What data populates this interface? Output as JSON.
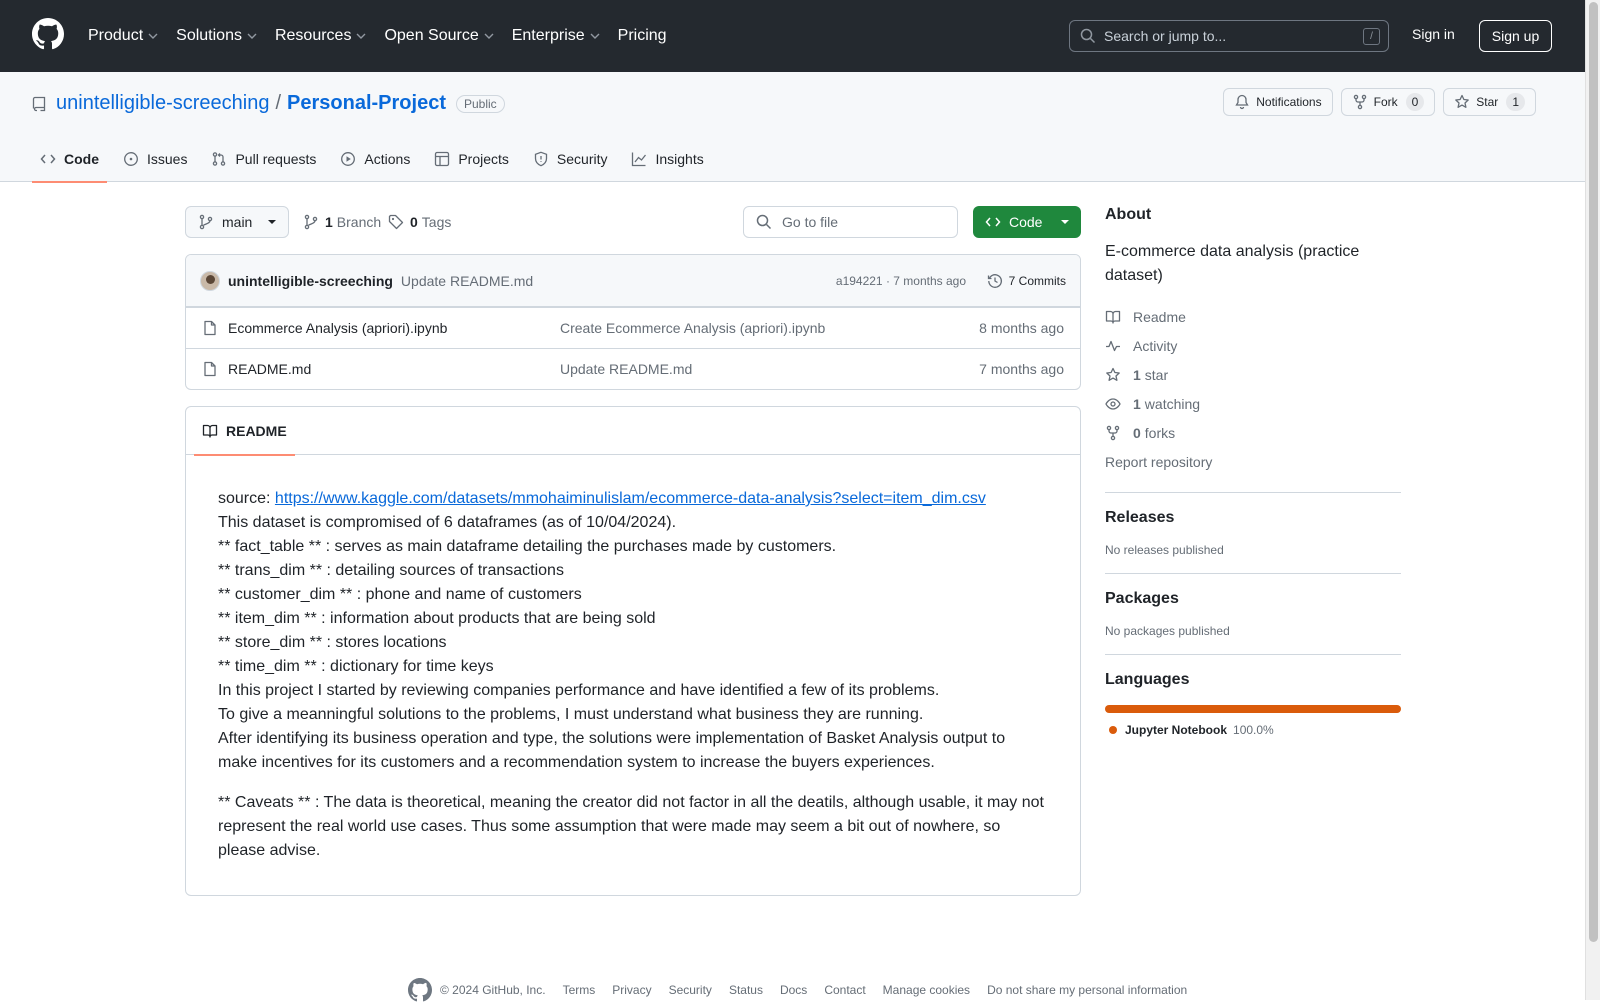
{
  "header": {
    "nav": [
      {
        "label": "Product",
        "has_menu": true
      },
      {
        "label": "Solutions",
        "has_menu": true
      },
      {
        "label": "Resources",
        "has_menu": true
      },
      {
        "label": "Open Source",
        "has_menu": true
      },
      {
        "label": "Enterprise",
        "has_menu": true
      },
      {
        "label": "Pricing",
        "has_menu": false
      }
    ],
    "search_placeholder": "Search or jump to...",
    "search_shortcut": "/",
    "sign_in": "Sign in",
    "sign_up": "Sign up"
  },
  "repo": {
    "owner": "unintelligible-screeching",
    "separator": "/",
    "name": "Personal-Project",
    "visibility": "Public",
    "notifications_label": "Notifications",
    "fork_label": "Fork",
    "fork_count": "0",
    "star_label": "Star",
    "star_count": "1",
    "tabs": [
      {
        "label": "Code",
        "icon": "code-icon",
        "active": true
      },
      {
        "label": "Issues",
        "icon": "issue-icon",
        "active": false
      },
      {
        "label": "Pull requests",
        "icon": "pull-request-icon",
        "active": false
      },
      {
        "label": "Actions",
        "icon": "play-icon",
        "active": false
      },
      {
        "label": "Projects",
        "icon": "table-icon",
        "active": false
      },
      {
        "label": "Security",
        "icon": "shield-icon",
        "active": false
      },
      {
        "label": "Insights",
        "icon": "graph-icon",
        "active": false
      }
    ]
  },
  "toolbar": {
    "branch": "main",
    "branch_count": "1",
    "branch_label": "Branch",
    "tag_count": "0",
    "tag_label": "Tags",
    "goto_placeholder": "Go to file",
    "code_button": "Code"
  },
  "latest_commit": {
    "author": "unintelligible-screeching",
    "message": "Update README.md",
    "meta": "a194221 · 7 months ago",
    "commits_label": "7 Commits"
  },
  "files": [
    {
      "name": "Ecommerce Analysis (apriori).ipynb",
      "message": "Create Ecommerce Analysis (apriori).ipynb",
      "date": "8 months ago"
    },
    {
      "name": "README.md",
      "message": "Update README.md",
      "date": "7 months ago"
    }
  ],
  "readme": {
    "tab_label": "README",
    "source_prefix": "source: ",
    "source_url": "https://www.kaggle.com/datasets/mmohaiminulislam/ecommerce-data-analysis?select=item_dim.csv",
    "lines": [
      "This dataset is compromised of 6 dataframes (as of 10/04/2024).",
      "** fact_table ** : serves as main dataframe detailing the purchases made by customers.",
      "** trans_dim ** : detailing sources of transactions",
      "** customer_dim ** : phone and name of customers",
      "** item_dim ** : information about products that are being sold",
      "** store_dim ** : stores locations",
      "** time_dim ** : dictionary for time keys",
      "In this project I started by reviewing companies performance and have identified a few of its problems.",
      "To give a meanningful solutions to the problems, I must understand what business they are running.",
      "After identifying its business operation and type, the solutions were implementation of Basket Analysis output to make incentives for its customers and a recommendation system to increase the buyers experiences."
    ],
    "caveats": "** Caveats ** : The data is theoretical, meaning the creator did not factor in all the deatils, although usable, it may not represent the real world use cases. Thus some assumption that were made may seem a bit out of nowhere, so please advise."
  },
  "sidebar": {
    "about_title": "About",
    "description": "E-commerce data analysis (practice dataset)",
    "links": [
      {
        "count": "",
        "label": "Readme",
        "icon": "book-icon"
      },
      {
        "count": "",
        "label": "Activity",
        "icon": "pulse-icon"
      },
      {
        "count": "1",
        "label": "star",
        "icon": "star-icon"
      },
      {
        "count": "1",
        "label": "watching",
        "icon": "eye-icon"
      },
      {
        "count": "0",
        "label": "forks",
        "icon": "fork-icon"
      }
    ],
    "report": "Report repository",
    "releases_title": "Releases",
    "releases_empty": "No releases published",
    "packages_title": "Packages",
    "packages_empty": "No packages published",
    "languages_title": "Languages",
    "languages": [
      {
        "name": "Jupyter Notebook",
        "percent": "100.0%",
        "color": "#da5b0b"
      }
    ]
  },
  "footer": {
    "copyright": "© 2024 GitHub, Inc.",
    "links": [
      "Terms",
      "Privacy",
      "Security",
      "Status",
      "Docs",
      "Contact",
      "Manage cookies",
      "Do not share my personal information"
    ]
  },
  "colors": {
    "header_bg": "#24292f",
    "link": "#0969da",
    "primary_button": "#1f883d",
    "active_tab_underline": "#fd8c73",
    "language_jupyter": "#da5b0b"
  }
}
